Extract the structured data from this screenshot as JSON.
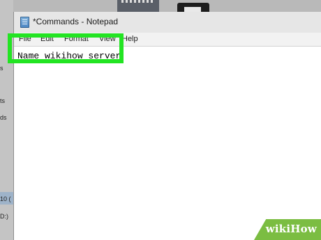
{
  "desktop": {
    "side_labels": [
      "s",
      "ts",
      "ds",
      "10 (",
      "D:)"
    ],
    "icons": [
      "notebook-icon",
      "folder-icon"
    ]
  },
  "window": {
    "title": "*Commands - Notepad",
    "icon": "notepad-icon"
  },
  "menu": {
    "items": [
      "File",
      "Edit",
      "Format",
      "View",
      "Help"
    ]
  },
  "editor": {
    "content": "Name wikihow_server"
  },
  "highlight": {
    "color": "#22e422"
  },
  "watermark": {
    "text": "wikiHow",
    "color": "#7bbd42"
  }
}
